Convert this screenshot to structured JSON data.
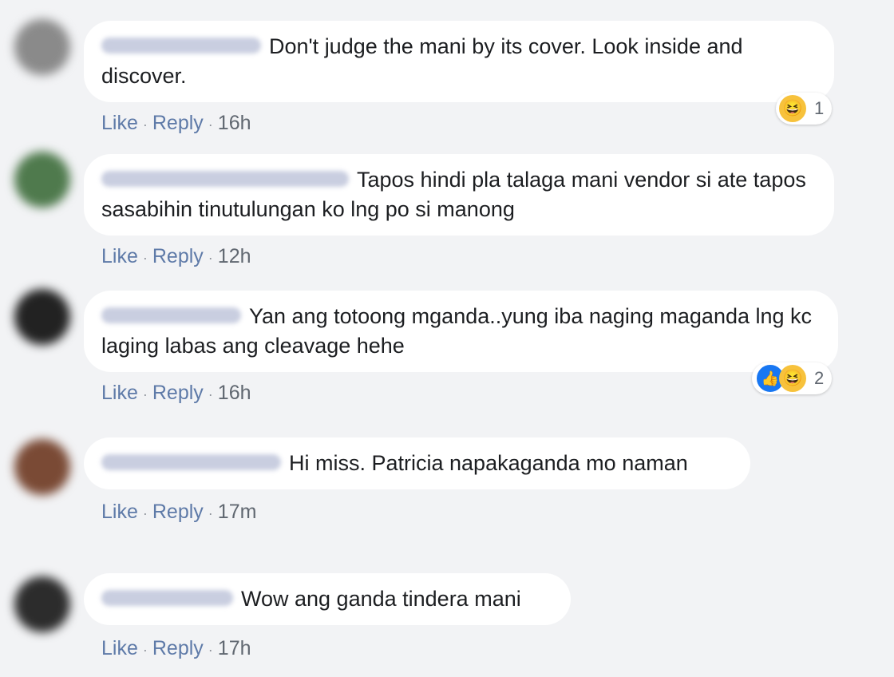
{
  "comments": [
    {
      "text": "Don't judge the mani by its cover. Look inside and discover.",
      "like": "Like",
      "reply": "Reply",
      "time": "16h",
      "reactions": {
        "types": [
          "haha-icon"
        ],
        "count": "1"
      }
    },
    {
      "text": "Tapos hindi pla talaga mani vendor si ate tapos sasabihin tinutulungan ko lng po si manong",
      "like": "Like",
      "reply": "Reply",
      "time": "12h"
    },
    {
      "text": "Yan ang totoong mganda..yung iba naging maganda lng kc laging labas ang cleavage hehe",
      "like": "Like",
      "reply": "Reply",
      "time": "16h",
      "reactions": {
        "types": [
          "like-icon",
          "haha-icon"
        ],
        "count": "2"
      }
    },
    {
      "text": "Hi miss. Patricia napakaganda mo naman",
      "like": "Like",
      "reply": "Reply",
      "time": "17m"
    },
    {
      "text": "Wow ang ganda tindera mani",
      "like": "Like",
      "reply": "Reply",
      "time": "17h"
    }
  ],
  "colors": {
    "background": "#f2f3f5",
    "bubble": "#ffffff",
    "action_link": "#5e7aa8",
    "like_reaction": "#1877f2",
    "haha_reaction": "#f7c23c"
  }
}
